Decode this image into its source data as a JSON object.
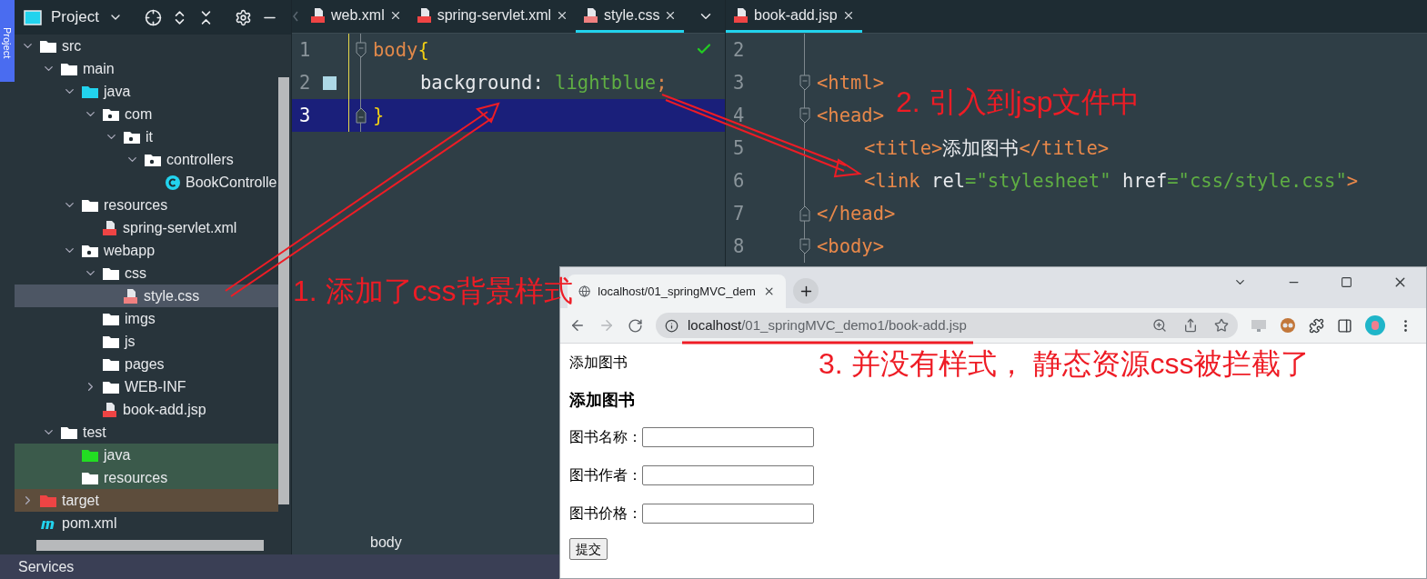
{
  "side_tab": {
    "label": "Project"
  },
  "project_panel": {
    "title": "Project",
    "tree": [
      {
        "label": "src",
        "kind": "folder",
        "expanded": true,
        "selected": false,
        "children": [
          {
            "label": "main",
            "kind": "folder",
            "expanded": true,
            "selected": false,
            "children": [
              {
                "label": "java",
                "kind": "source-folder",
                "expanded": true,
                "selected": false,
                "children": [
                  {
                    "label": "com",
                    "kind": "package",
                    "expanded": true,
                    "selected": false,
                    "children": [
                      {
                        "label": "it",
                        "kind": "package",
                        "expanded": true,
                        "selected": false,
                        "children": [
                          {
                            "label": "controllers",
                            "kind": "package",
                            "expanded": true,
                            "selected": false,
                            "children": [
                              {
                                "label": "BookControlle",
                                "kind": "class",
                                "selected": false
                              }
                            ]
                          }
                        ]
                      }
                    ]
                  }
                ]
              },
              {
                "label": "resources",
                "kind": "resources-folder",
                "expanded": true,
                "selected": false,
                "children": [
                  {
                    "label": "spring-servlet.xml",
                    "kind": "xml-file",
                    "selected": false
                  }
                ]
              },
              {
                "label": "webapp",
                "kind": "web-folder",
                "expanded": true,
                "selected": false,
                "children": [
                  {
                    "label": "css",
                    "kind": "folder",
                    "expanded": true,
                    "selected": false,
                    "children": [
                      {
                        "label": "style.css",
                        "kind": "css-file",
                        "selected": true
                      }
                    ]
                  },
                  {
                    "label": "imgs",
                    "kind": "folder",
                    "selected": false
                  },
                  {
                    "label": "js",
                    "kind": "folder",
                    "selected": false
                  },
                  {
                    "label": "pages",
                    "kind": "folder",
                    "selected": false
                  },
                  {
                    "label": "WEB-INF",
                    "kind": "folder",
                    "expanded": false,
                    "selected": false
                  },
                  {
                    "label": "book-add.jsp",
                    "kind": "jsp-file",
                    "selected": false
                  }
                ]
              }
            ]
          },
          {
            "label": "test",
            "kind": "folder",
            "expanded": true,
            "selected": false,
            "children": [
              {
                "label": "java",
                "kind": "test-source-folder",
                "selected": false
              },
              {
                "label": "resources",
                "kind": "test-resources-folder",
                "selected": false
              }
            ]
          }
        ]
      },
      {
        "label": "target",
        "kind": "excluded-folder",
        "expanded": false,
        "selected": false
      },
      {
        "label": "pom.xml",
        "kind": "maven-file",
        "selected": false
      }
    ]
  },
  "services_bar": {
    "label": "Services"
  },
  "editors": [
    {
      "tabs": [
        {
          "label": "web.xml",
          "kind": "xml-web",
          "selected": false
        },
        {
          "label": "spring-servlet.xml",
          "kind": "xml-spring",
          "selected": false
        },
        {
          "label": "style.css",
          "kind": "css",
          "selected": true
        }
      ],
      "inspections_ok": true,
      "lines": [
        {
          "number": "1",
          "kind": "fold-start",
          "current": false,
          "indented": false,
          "tokens": [
            {
              "text": "body",
              "kind": "selector"
            },
            {
              "text": "{",
              "kind": "brace"
            }
          ]
        },
        {
          "number": "2",
          "kind": "plain",
          "color": "#add8e6",
          "current": false,
          "indented": true,
          "tokens": [
            {
              "text": "background: ",
              "kind": "property"
            },
            {
              "text": "lightblue",
              "kind": "value"
            },
            {
              "text": ";",
              "kind": "punct"
            }
          ]
        },
        {
          "number": "3",
          "kind": "fold-end",
          "current": true,
          "indented": false,
          "tokens": [
            {
              "text": "}",
              "kind": "brace"
            }
          ]
        }
      ],
      "breadcrumb": "body"
    },
    {
      "tabs": [
        {
          "label": "book-add.jsp",
          "kind": "jsp",
          "selected": true
        }
      ],
      "lines": [
        {
          "number": "2",
          "kind": "plain",
          "current": false
        },
        {
          "number": "3",
          "kind": "fold-start",
          "current": false,
          "indented": false,
          "tokens": [
            {
              "text": "<html>",
              "kind": "tag"
            }
          ]
        },
        {
          "number": "4",
          "kind": "fold-start",
          "current": false,
          "indented": false,
          "tokens": [
            {
              "text": "<head>",
              "kind": "tag"
            }
          ]
        },
        {
          "number": "5",
          "kind": "plain",
          "current": false,
          "indented": true,
          "tokens": [
            {
              "text": "<title>",
              "kind": "tag"
            },
            {
              "text": "添加图书",
              "kind": "text"
            },
            {
              "text": "</title>",
              "kind": "tag"
            }
          ]
        },
        {
          "number": "6",
          "kind": "plain",
          "current": false,
          "indented": true,
          "tokens": [
            {
              "text": "<link",
              "kind": "tag"
            },
            {
              "text": " rel",
              "kind": "attr"
            },
            {
              "text": "=\"stylesheet\"",
              "kind": "value"
            },
            {
              "text": " href",
              "kind": "attr"
            },
            {
              "text": "=\"css/style.css\"",
              "kind": "value"
            },
            {
              "text": ">",
              "kind": "tag"
            }
          ]
        },
        {
          "number": "7",
          "kind": "fold-end",
          "current": false,
          "indented": false,
          "tokens": [
            {
              "text": "</head>",
              "kind": "tag"
            }
          ]
        },
        {
          "number": "8",
          "kind": "fold-start",
          "current": false,
          "indented": false,
          "tokens": [
            {
              "text": "<body>",
              "kind": "tag"
            }
          ]
        }
      ]
    }
  ],
  "browser": {
    "tabs": [
      {
        "title": "localhost/01_springMVC_dem",
        "selected": true
      }
    ],
    "address": {
      "host": "localhost",
      "path": "/01_springMVC_demo1/book-add.jsp"
    },
    "page": {
      "text": "添加图书",
      "heading": "添加图书",
      "fields": [
        {
          "label": "图书名称："
        },
        {
          "label": "图书作者："
        },
        {
          "label": "图书价格："
        }
      ],
      "submit": "提交"
    }
  },
  "annotations": [
    {
      "text": "1. 添加了css背景样式"
    },
    {
      "text": "2. 引入到jsp文件中"
    },
    {
      "text": "3. 并没有样式， 静态资源css被拦截了"
    }
  ]
}
